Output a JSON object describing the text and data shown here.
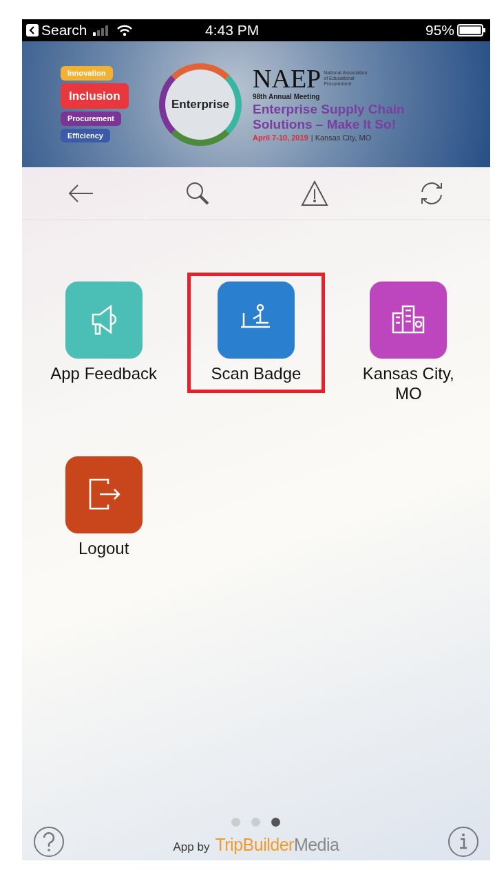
{
  "status_bar": {
    "back_label": "Search",
    "time": "4:43 PM",
    "battery": "95%"
  },
  "banner": {
    "pillars": [
      {
        "label": "Innovation",
        "color": "#f2b134"
      },
      {
        "label": "Inclusion",
        "color": "#e8383d"
      },
      {
        "label": "Procurement",
        "color": "#7b3596"
      },
      {
        "label": "Efficiency",
        "color": "#3b5ba9"
      }
    ],
    "ring_label": "Enterprise",
    "org": "NAEP",
    "org_full": "National Association of Educational Procurement",
    "meeting": "98th Annual Meeting",
    "theme_lines": [
      "Enterprise Supply Chain",
      "Solutions – Make It So!"
    ],
    "dates": "April 7-10, 2019",
    "location": "| Kansas City, MO"
  },
  "toolbar": [
    {
      "kind": "back"
    },
    {
      "kind": "search"
    },
    {
      "kind": "alert"
    },
    {
      "kind": "refresh"
    }
  ],
  "tiles": [
    {
      "label": "App Feedback",
      "kind": "megaphone",
      "color": "#4bbfb5",
      "highlighted": false
    },
    {
      "label": "Scan Badge",
      "kind": "scanner",
      "color": "#2a7fcf",
      "highlighted": true
    },
    {
      "label": "Kansas City, MO",
      "kind": "buildings",
      "color": "#bd45bd",
      "highlighted": false
    },
    {
      "label": "Logout",
      "kind": "logout",
      "color": "#c9461c",
      "highlighted": false
    }
  ],
  "pages": [
    {
      "selected": false
    },
    {
      "selected": false
    },
    {
      "selected": true
    }
  ],
  "footer": {
    "prefix": "App by",
    "brand_a": "TripBuilder",
    "brand_b": "Media"
  }
}
